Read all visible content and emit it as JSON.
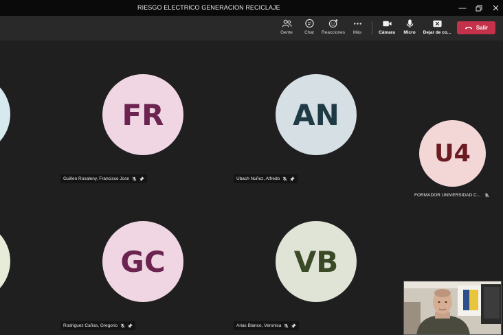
{
  "window": {
    "title": "RIESGO ELECTRICO GENERACION RECICLAJE",
    "controls": [
      "minimize",
      "restore",
      "close"
    ]
  },
  "toolbar": {
    "items": [
      {
        "label": "Gente",
        "icon": "people-icon"
      },
      {
        "label": "Chat",
        "icon": "chat-icon"
      },
      {
        "label": "Reacciones",
        "icon": "reactions-icon"
      },
      {
        "label": "Más",
        "icon": "more-icon"
      },
      {
        "label": "Cámara",
        "icon": "camera-icon"
      },
      {
        "label": "Micro",
        "icon": "mic-icon"
      },
      {
        "label": "Dejar de co...",
        "icon": "stop-share-icon"
      }
    ],
    "leave_label": "Salir"
  },
  "participants": [
    {
      "initials": "FR",
      "name": "Guillen Rosaleny, Francisco Jose",
      "bg": "#f0d6e3",
      "fg": "#6b2350",
      "muted": true,
      "pinned": true
    },
    {
      "initials": "AN",
      "name": "Ubach Nuñez, Alfredo",
      "bg": "#d6dfe4",
      "fg": "#1e3a44",
      "muted": true,
      "pinned": true
    },
    {
      "initials": "U4",
      "name": "FORMADOR UNIVERSIDAD C...",
      "bg": "#f3d6d6",
      "fg": "#6a1c22",
      "muted": true,
      "pinned": false
    },
    {
      "initials": "GC",
      "name": "Rodriguez Cañas, Gregorio",
      "bg": "#f0d6e3",
      "fg": "#6b2350",
      "muted": true,
      "pinned": true
    },
    {
      "initials": "VB",
      "name": "Arias Blanco, Veronica",
      "bg": "#dfe4d6",
      "fg": "#3b4a26",
      "muted": true,
      "pinned": true
    }
  ],
  "edge_avatars": [
    {
      "bg": "#d6e9ee"
    },
    {
      "bg": "#e6ecd8"
    }
  ]
}
